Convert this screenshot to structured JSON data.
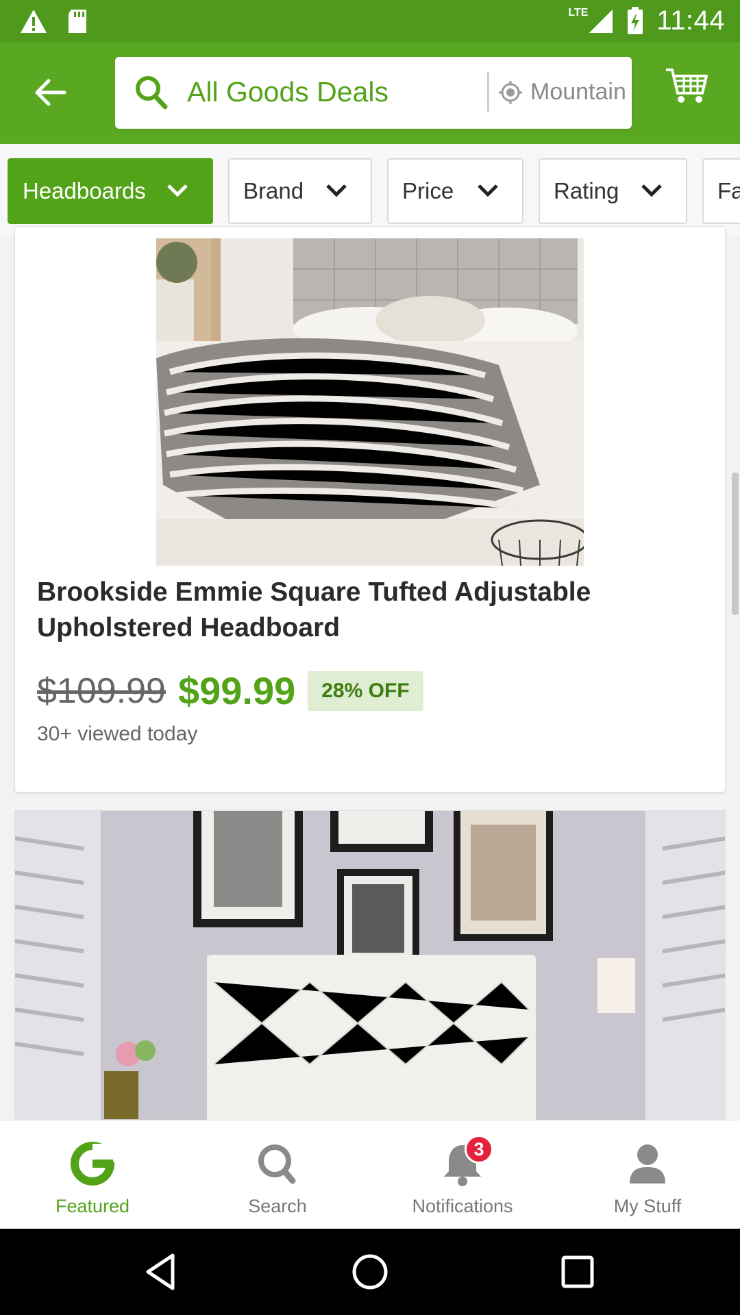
{
  "status_bar": {
    "time": "11:44",
    "network": "LTE"
  },
  "header": {
    "search_text": "All Goods Deals",
    "location_text": "Mountain View"
  },
  "filters": [
    {
      "label": "Headboards",
      "active": true
    },
    {
      "label": "Brand",
      "active": false
    },
    {
      "label": "Price",
      "active": false
    },
    {
      "label": "Rating",
      "active": false
    },
    {
      "label": "Fa",
      "active": false
    }
  ],
  "product": {
    "title": "Brookside Emmie Square Tufted Adjustable Upholstered Headboard",
    "original_price": "$109.99",
    "sale_price": "$99.99",
    "discount": "28% OFF",
    "views": "30+ viewed today"
  },
  "bottom_nav": {
    "items": [
      {
        "label": "Featured",
        "icon": "groupon-g-icon"
      },
      {
        "label": "Search",
        "icon": "search-icon"
      },
      {
        "label": "Notifications",
        "icon": "bell-icon"
      },
      {
        "label": "My Stuff",
        "icon": "person-icon"
      }
    ],
    "notification_count": "3"
  },
  "colors": {
    "brand_green": "#53a318",
    "status_green": "#4f9a1c",
    "badge_red": "#e5213b"
  }
}
